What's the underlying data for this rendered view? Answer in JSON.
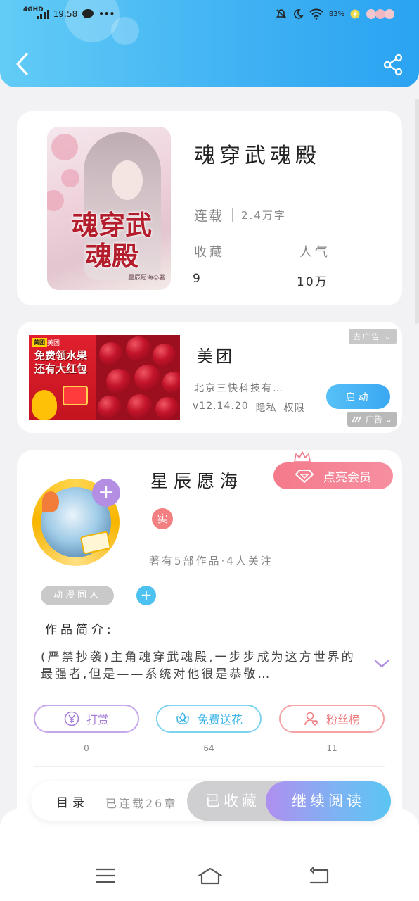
{
  "status_bar": {
    "network": "4GHD",
    "time": "19:58",
    "more": "•••",
    "battery": "83%"
  },
  "book": {
    "cover_title": "魂穿武魂殿",
    "cover_author": "星辰愿海◎著",
    "title": "魂穿武魂殿",
    "status": "连载",
    "word_count": "2.4万字",
    "favorites_label": "收藏",
    "favorites_value": "9",
    "popularity_label": "人气",
    "popularity_value": "10万"
  },
  "ad": {
    "brand_tag": "美团",
    "slogan_line1": "免费领水果",
    "slogan_line2": "还有大红包",
    "name": "美团",
    "company": "北京三快科技有…",
    "version": "v12.14.20",
    "privacy": "隐私",
    "permissions": "权限",
    "remove_label": "去广告",
    "launch_label": "启动",
    "ad_label": "广告"
  },
  "author": {
    "name": "星辰愿海",
    "vip_label": "点亮会员",
    "real_badge": "实",
    "stats": "著有5部作品·4人关注",
    "tag": "动漫同人",
    "tag_add": "+",
    "intro_label": "作品简介:",
    "intro_text": "(严禁抄袭)主角魂穿武魂殿,一步步成为这方世界的最强者,但是——系统对他很是恭敬…",
    "actions": [
      {
        "label": "打赏",
        "count": "0"
      },
      {
        "label": "免费送花",
        "count": "64"
      },
      {
        "label": "粉丝榜",
        "count": "11"
      }
    ]
  },
  "bottom_bar": {
    "toc_label": "目录",
    "serialized_label": "已连载26章",
    "collected_label": "已收藏",
    "continue_label": "继续阅读"
  },
  "colors": {
    "header_blue": "#3fb1f3",
    "vip_pink": "#f47a8a",
    "reward_purple": "#a57dd8",
    "flower_blue": "#3fb6e6",
    "fans_red": "#ef7d80"
  }
}
